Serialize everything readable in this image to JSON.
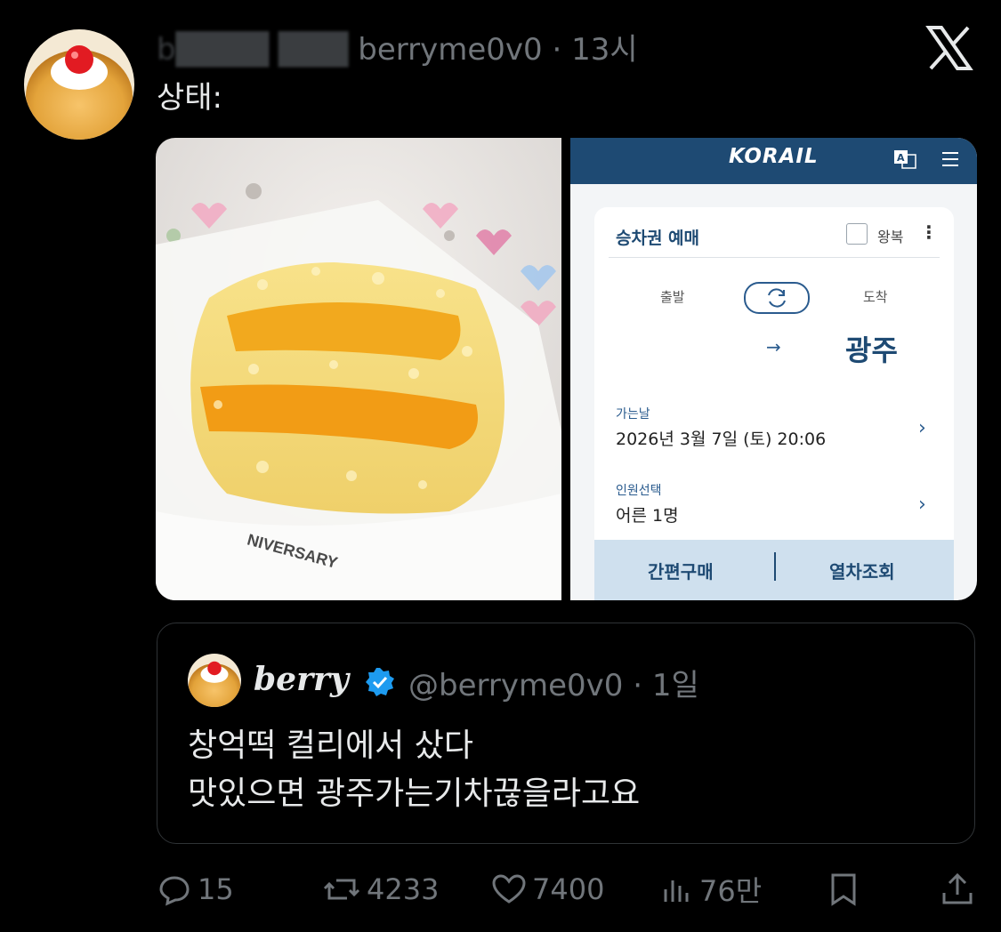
{
  "tweet": {
    "author_handle_fragment": "berryme0v0",
    "author_name_partial": "b",
    "time": "· 13시",
    "text": "상태:"
  },
  "korail": {
    "logo": "KORAIL",
    "title": "승차권 예매",
    "round_trip": "왕복",
    "depart_label": "출발",
    "arrive_label": "도착",
    "destination": "광주",
    "date_label": "가는날",
    "date_value": "2026년 3월 7일 (토) 20:06",
    "people_label": "인원선택",
    "people_value": "어른 1명",
    "quick_buy": "간편구매",
    "train_search": "열차조회"
  },
  "food_image": {
    "plate_text": "NIVERSARY"
  },
  "quote": {
    "name": "berry",
    "handle": "@berryme0v0",
    "time": "· 1일",
    "line1": "창억떡 컬리에서 샀다",
    "line2": "맛있으면 광주가는기차끊을라고요"
  },
  "actions": {
    "replies": "15",
    "retweets": "4233",
    "likes": "7400",
    "views": "76만"
  },
  "colors": {
    "background": "#000000",
    "text": "#e7e9ea",
    "muted": "#71767b",
    "verified": "#1d9bf0",
    "korail_navy": "#1e4a73"
  }
}
